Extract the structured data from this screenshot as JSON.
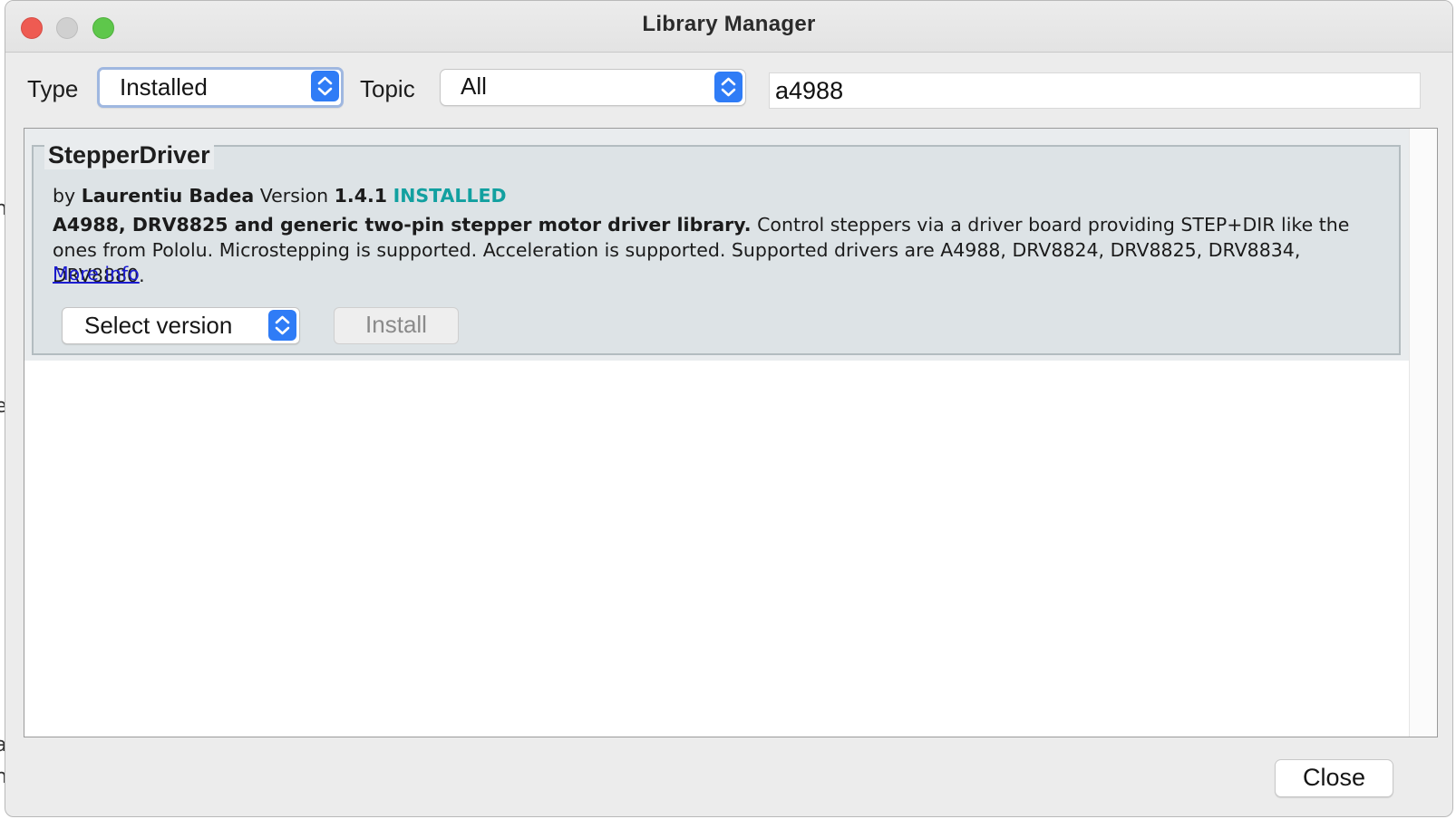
{
  "window": {
    "title": "Library Manager"
  },
  "filters": {
    "type_label": "Type",
    "type_value": "Installed",
    "topic_label": "Topic",
    "topic_value": "All",
    "search_value": "a4988"
  },
  "library": {
    "name": "StepperDriver",
    "by": "by",
    "author": "Laurentiu Badea",
    "version_label": "Version",
    "version": "1.4.1",
    "status": "INSTALLED",
    "summary": "A4988, DRV8825 and generic two-pin stepper motor driver library.",
    "description": "Control steppers via a driver board providing STEP+DIR like the ones from Pololu. Microstepping is supported. Acceleration is supported. Supported drivers are A4988, DRV8824, DRV8825, DRV8834, DRV8880.",
    "more_info": "More info",
    "select_version": "Select version",
    "install_label": "Install"
  },
  "footer": {
    "close_label": "Close"
  },
  "colors": {
    "accent": "#2f7cf6",
    "installed": "#12a0a0",
    "link": "#1b1bd0"
  }
}
